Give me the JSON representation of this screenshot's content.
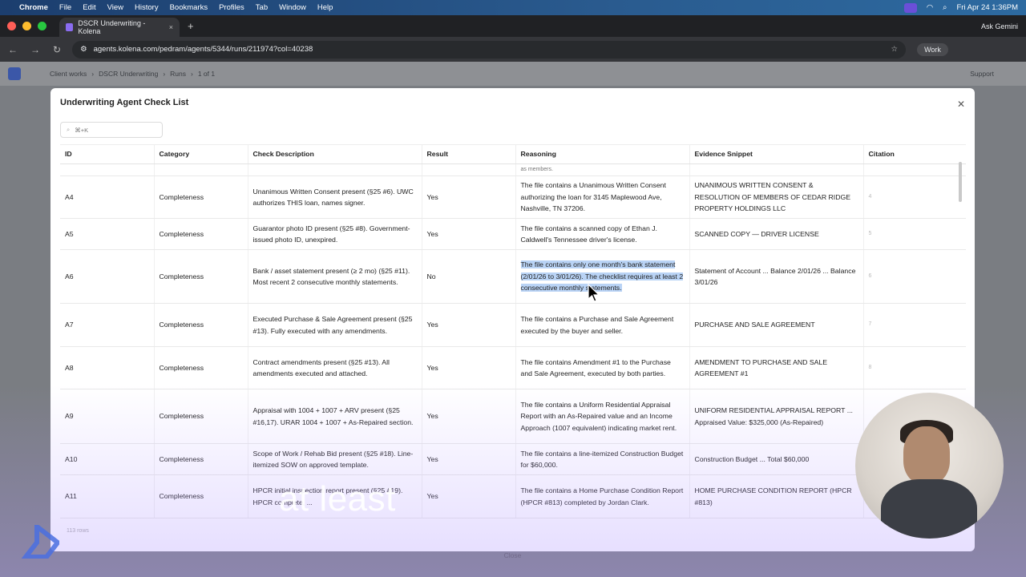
{
  "menubar": {
    "app": "Chrome",
    "items": [
      "File",
      "Edit",
      "View",
      "History",
      "Bookmarks",
      "Profiles",
      "Tab",
      "Window",
      "Help"
    ],
    "clock": "Fri Apr 24  1:36PM"
  },
  "browser": {
    "tab_title": "DSCR Underwriting - Kolena",
    "url": "agents.kolena.com/pedram/agents/5344/runs/211974?col=40238",
    "gemini": "Ask Gemini",
    "profile": "Work"
  },
  "appnav": {
    "crumbs": [
      "Client works",
      "DSCR Underwriting",
      "Runs",
      "1 of 1"
    ],
    "support": "Support"
  },
  "modal": {
    "title": "Underwriting Agent Check List",
    "search_placeholder": "⌘+K",
    "columns": [
      "ID",
      "Category",
      "Check Description",
      "Result",
      "Reasoning",
      "Evidence Snippet",
      "Citation"
    ],
    "cut_top": "as members.",
    "rows": [
      {
        "id": "A4",
        "category": "Completeness",
        "desc": "Unanimous Written Consent present (§25 #6). UWC authorizes THIS loan, names signer.",
        "result": "Yes",
        "reasoning": "The file contains a Unanimous Written Consent authorizing the loan for 3145 Maplewood Ave, Nashville, TN 37206.",
        "evidence": "UNANIMOUS WRITTEN CONSENT & RESOLUTION OF MEMBERS OF CEDAR RIDGE PROPERTY HOLDINGS LLC",
        "citation": "4"
      },
      {
        "id": "A5",
        "category": "Completeness",
        "desc": "Guarantor photo ID present (§25 #8). Government-issued photo ID, unexpired.",
        "result": "Yes",
        "reasoning": "The file contains a scanned copy of Ethan J. Caldwell's Tennessee driver's license.",
        "evidence": "SCANNED COPY — DRIVER LICENSE",
        "citation": "5"
      },
      {
        "id": "A6",
        "category": "Completeness",
        "desc": "Bank / asset statement present (≥ 2 mo) (§25 #11). Most recent 2 consecutive monthly statements.",
        "result": "No",
        "reasoning": "The file contains only one month's bank statement (2/01/26 to 3/01/26). The checklist requires at least 2 consecutive monthly statements.",
        "evidence": "Statement of Account ... Balance 2/01/26 ... Balance 3/01/26",
        "citation": "6"
      },
      {
        "id": "A7",
        "category": "Completeness",
        "desc": "Executed Purchase & Sale Agreement present (§25 #13). Fully executed with any amendments.",
        "result": "Yes",
        "reasoning": "The file contains a Purchase and Sale Agreement executed by the buyer and seller.",
        "evidence": "PURCHASE AND SALE AGREEMENT",
        "citation": "7"
      },
      {
        "id": "A8",
        "category": "Completeness",
        "desc": "Contract amendments present (§25 #13). All amendments executed and attached.",
        "result": "Yes",
        "reasoning": "The file contains Amendment #1 to the Purchase and Sale Agreement, executed by both parties.",
        "evidence": "AMENDMENT TO PURCHASE AND SALE AGREEMENT #1",
        "citation": "8"
      },
      {
        "id": "A9",
        "category": "Completeness",
        "desc": "Appraisal with 1004 + 1007 + ARV present (§25 #16,17). URAR 1004 + 1007 + As-Repaired section.",
        "result": "Yes",
        "reasoning": "The file contains a Uniform Residential Appraisal Report with an As-Repaired value and an Income Approach (1007 equivalent) indicating market rent.",
        "evidence": "UNIFORM RESIDENTIAL APPRAISAL REPORT ... Appraised Value: $325,000 (As-Repaired)",
        "citation": ""
      },
      {
        "id": "A10",
        "category": "Completeness",
        "desc": "Scope of Work / Rehab Bid present (§25 #18). Line-itemized SOW on approved template.",
        "result": "Yes",
        "reasoning": "The file contains a line-itemized Construction Budget for $60,000.",
        "evidence": "Construction Budget ... Total $60,000",
        "citation": ""
      },
      {
        "id": "A11",
        "category": "Completeness",
        "desc": "HPCR initial inspection report present (§25 #19). HPCR complete, ...",
        "result": "Yes",
        "reasoning": "The file contains a Home Purchase Condition Report (HPCR #813) completed by Jordan Clark.",
        "evidence": "HOME PURCHASE CONDITION REPORT (HPCR #813)",
        "citation": ""
      }
    ],
    "row_count": "113 rows",
    "close_label": "Close"
  },
  "caption": "at least",
  "colors": {
    "accent": "#3b57a8",
    "highlight": "#b9d3f5"
  }
}
